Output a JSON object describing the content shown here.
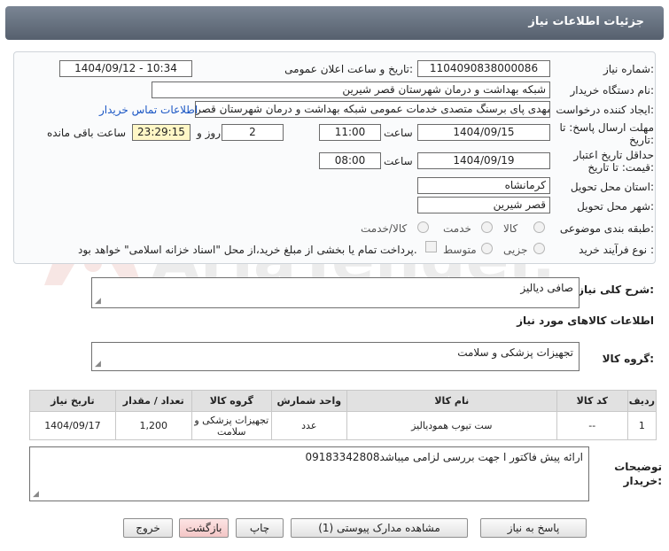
{
  "header": {
    "title": "جزئیات اطلاعات نیاز"
  },
  "form": {
    "need_number_label": "شماره نیاز:",
    "need_number": "1104090838000086",
    "announce_label": "تاریخ و ساعت اعلان عمومی:",
    "announce_value": "1404/09/12 - 10:34",
    "buyer_org_label": "نام دستگاه خریدار:",
    "buyer_org": "شبکه بهداشت و درمان شهرستان قصر شیرین",
    "creator_label": "ایجاد کننده درخواست:",
    "creator": "مهدی پای برسنگ متصدی خدمات عمومی شبکه بهداشت و درمان شهرستان قصر",
    "contact_link": "اطلاعات تماس خریدار",
    "deadline_label_1": "مهلت ارسال پاسخ: تا",
    "deadline_label_2": "تاریخ:",
    "deadline_date": "1404/09/15",
    "time_label": "ساعت",
    "deadline_time": "11:00",
    "days_value": "2",
    "days_label": "روز و",
    "remaining_time": "23:29:15",
    "remaining_label": "ساعت باقی مانده",
    "validity_label_1": "حداقل تاریخ اعتبار",
    "validity_label_2": "قیمت: تا تاریخ:",
    "validity_date": "1404/09/19",
    "validity_time": "08:00",
    "province_label": "استان محل تحویل:",
    "province": "کرمانشاه",
    "city_label": "شهر محل تحویل:",
    "city": "قصر شیرین",
    "category_label": "طبقه بندی موضوعی:",
    "category_options": [
      "کالا",
      "خدمت",
      "کالا/خدمت"
    ],
    "purchase_type_label": "نوع فرآیند خرید :",
    "purchase_options": [
      "جزیی",
      "متوسط"
    ],
    "payment_note": "پرداخت تمام یا بخشی از مبلغ خرید،از محل \"اسناد خزانه اسلامی\" خواهد بود."
  },
  "description": {
    "label": "شرح کلی نیاز:",
    "value": "صافی دیالیز"
  },
  "goods": {
    "section_title": "اطلاعات کالاهای مورد نیاز",
    "group_label": "گروه کالا:",
    "group_value": "تجهیزات پزشکی و سلامت"
  },
  "table": {
    "headers": [
      "ردیف",
      "کد کالا",
      "نام کالا",
      "واحد شمارش",
      "گروه کالا",
      "تعداد / مقدار",
      "تاریخ نیاز"
    ],
    "rows": [
      [
        "1",
        "--",
        "ست تیوب همودیالیز",
        "عدد",
        "تجهیزات پزشکی و سلامت",
        "1,200",
        "1404/09/17"
      ]
    ]
  },
  "buyer_notes": {
    "label_1": "توضیحات",
    "label_2": "خریدار:",
    "value": "ارائه  پیش فاکتور ا جهت بررسی لزامی میباشد09183342808"
  },
  "buttons": {
    "reply": "پاسخ به نیاز",
    "attachments": "مشاهده مدارک پیوستی (1)",
    "print": "چاپ",
    "back": "بازگشت",
    "exit": "خروج"
  },
  "watermark": {
    "text": "AriaTender.net"
  },
  "colors": {
    "titlebar": "#5f6a78",
    "link": "#1a56c4",
    "remaining_bg": "#fff7c6"
  }
}
